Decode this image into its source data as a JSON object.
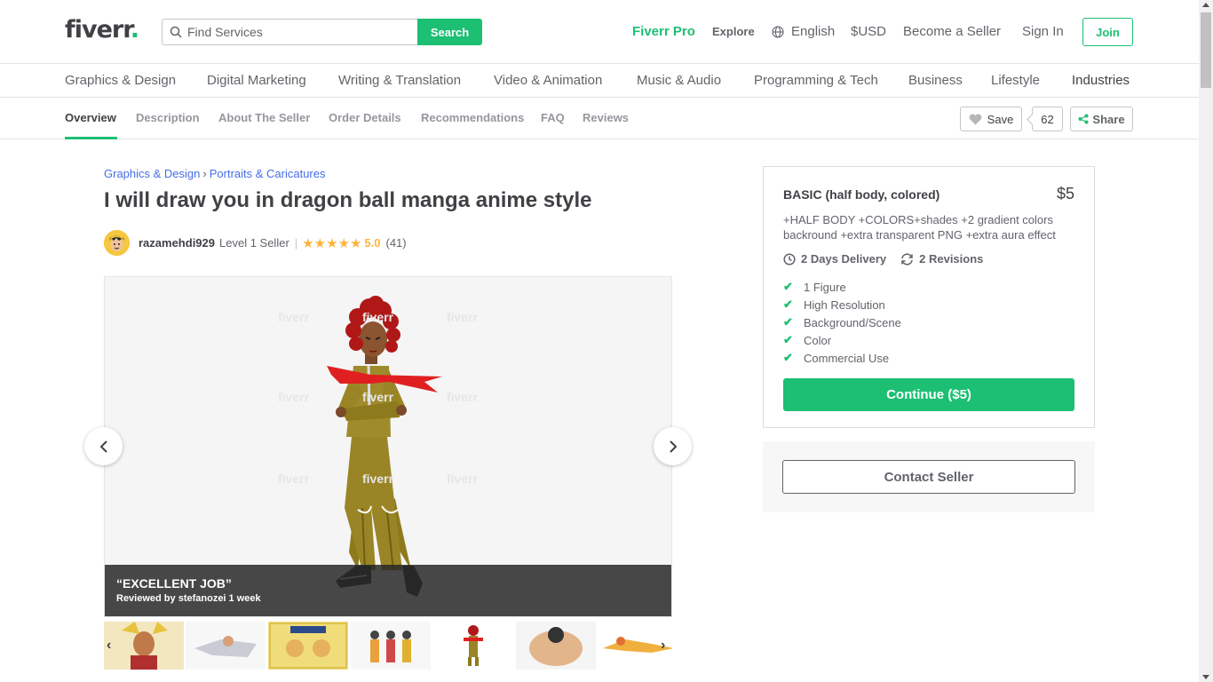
{
  "header": {
    "logo_text": "fiverr",
    "logo_dot": ".",
    "search_placeholder": "Find Services",
    "search_button": "Search",
    "fiverr_pro": "Fiverr Pro",
    "explore": "Explore",
    "language": "English",
    "currency": "$USD",
    "become_seller": "Become a Seller",
    "sign_in": "Sign In",
    "join": "Join"
  },
  "categories": [
    "Graphics & Design",
    "Digital Marketing",
    "Writing & Translation",
    "Video & Animation",
    "Music & Audio",
    "Programming & Tech",
    "Business",
    "Lifestyle",
    "Industries"
  ],
  "subnav": {
    "tabs": [
      "Overview",
      "Description",
      "About The Seller",
      "Order Details",
      "Recommendations",
      "FAQ",
      "Reviews"
    ],
    "save_label": "Save",
    "save_count": "62",
    "share_label": "Share"
  },
  "breadcrumb": {
    "first": "Graphics & Design",
    "separator": "›",
    "second": "Portraits & Caricatures"
  },
  "gig": {
    "title": "I will draw you in dragon ball manga anime style",
    "seller_name": "razamehdi929",
    "seller_level": "Level 1 Seller",
    "separator": "|",
    "stars": "★★★★★",
    "rating": "5.0",
    "rating_count": "(41)"
  },
  "gallery": {
    "review_quote": "“EXCELLENT JOB”",
    "review_by": "Reviewed by stefanozei 1 week"
  },
  "package": {
    "name": "BASIC (half body, colored)",
    "price": "$5",
    "description": "+HALF BODY +COLORS+shades +2 gradient colors backround +extra transparent PNG +extra aura effect",
    "delivery": "2 Days Delivery",
    "revisions": "2 Revisions",
    "features": [
      "1 Figure",
      "High Resolution",
      "Background/Scene",
      "Color",
      "Commercial Use"
    ],
    "continue_label": "Continue ($5)",
    "contact_label": "Contact Seller"
  },
  "colors": {
    "brand_green": "#1dbf73",
    "star_yellow": "#ffb33e",
    "link_blue": "#446ee7"
  }
}
